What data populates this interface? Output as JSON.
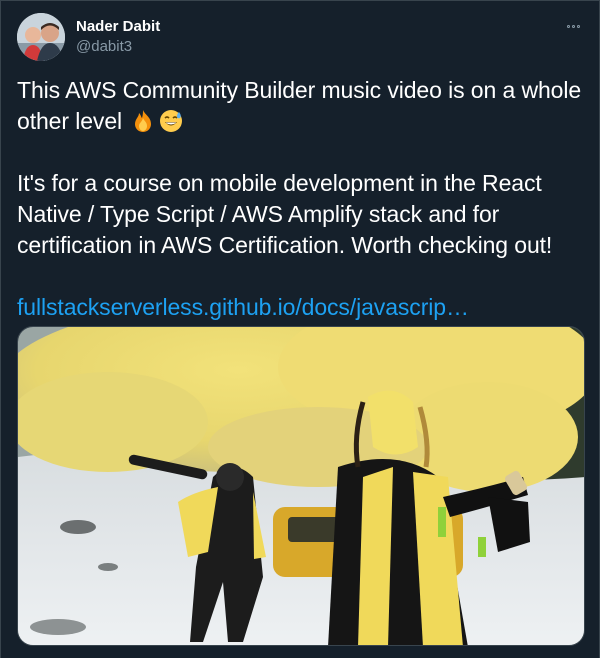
{
  "author": {
    "display_name": "Nader Dabit",
    "handle": "@dabit3",
    "avatar_icon": "avatar-photo"
  },
  "tweet": {
    "line1": "This AWS Community Builder music video is on a whole other level",
    "emojis": [
      "fire-emoji",
      "sweat-smile-emoji"
    ],
    "line2": "It's for a course on mobile development in the React Native / Type Script / AWS Amplify stack and for certification in AWS Certification. Worth checking out!",
    "link_text": "fullstackserverless.github.io/docs/javascrip…"
  },
  "media": {
    "description_icon": "video-thumbnail"
  },
  "colors": {
    "background": "#15202b",
    "text": "#ffffff",
    "secondary": "#8899a6",
    "link": "#1da1f2",
    "border": "#38444d"
  }
}
